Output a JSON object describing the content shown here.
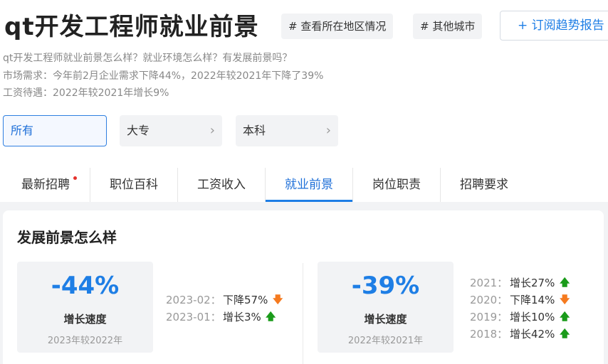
{
  "header": {
    "title": "qt开发工程师就业前景",
    "tag1": "# 查看所在地区情况",
    "tag2": "# 其他城市",
    "subscribe": "+ 订阅趋势报告"
  },
  "description": [
    "qt开发工程师就业前景怎么样？就业环境怎么样？有发展前景吗？",
    "市场需求：今年前2月企业需求下降44%，2022年较2021年下降了39%",
    "工资待遇：2022年较2021年增长9%"
  ],
  "education_filters": [
    {
      "label": "所有",
      "active": true
    },
    {
      "label": "大专",
      "active": false
    },
    {
      "label": "本科",
      "active": false
    }
  ],
  "tabs": [
    {
      "label": "最新招聘",
      "badge": true
    },
    {
      "label": "职位百科"
    },
    {
      "label": "工资收入"
    },
    {
      "label": "就业前景",
      "active": true
    },
    {
      "label": "岗位职责"
    },
    {
      "label": "招聘要求"
    }
  ],
  "section": {
    "title": "发展前景怎么样",
    "stat_left": {
      "value": "-44%",
      "label": "增长速度",
      "note": "2023年较2022年"
    },
    "monthly": [
      {
        "key": "2023-02：",
        "value": "下降57%",
        "trend": "down"
      },
      {
        "key": "2023-01：",
        "value": "增长3%",
        "trend": "up"
      }
    ],
    "stat_right": {
      "value": "-39%",
      "label": "增长速度",
      "note": "2022年较2021年"
    },
    "yearly": [
      {
        "key": "2021：",
        "value": "增长27%",
        "trend": "up"
      },
      {
        "key": "2020：",
        "value": "下降14%",
        "trend": "down"
      },
      {
        "key": "2019：",
        "value": "增长10%",
        "trend": "up"
      },
      {
        "key": "2018：",
        "value": "增长42%",
        "trend": "up"
      }
    ]
  },
  "colors": {
    "accent": "#1e7ee5",
    "up": "#1a9b1a",
    "down": "#f57a1f",
    "badge": "#e5322d"
  },
  "icons": {
    "arrow_up": "arrow-up-icon",
    "arrow_down": "arrow-down-icon",
    "chevron": "chevron-right-icon"
  }
}
